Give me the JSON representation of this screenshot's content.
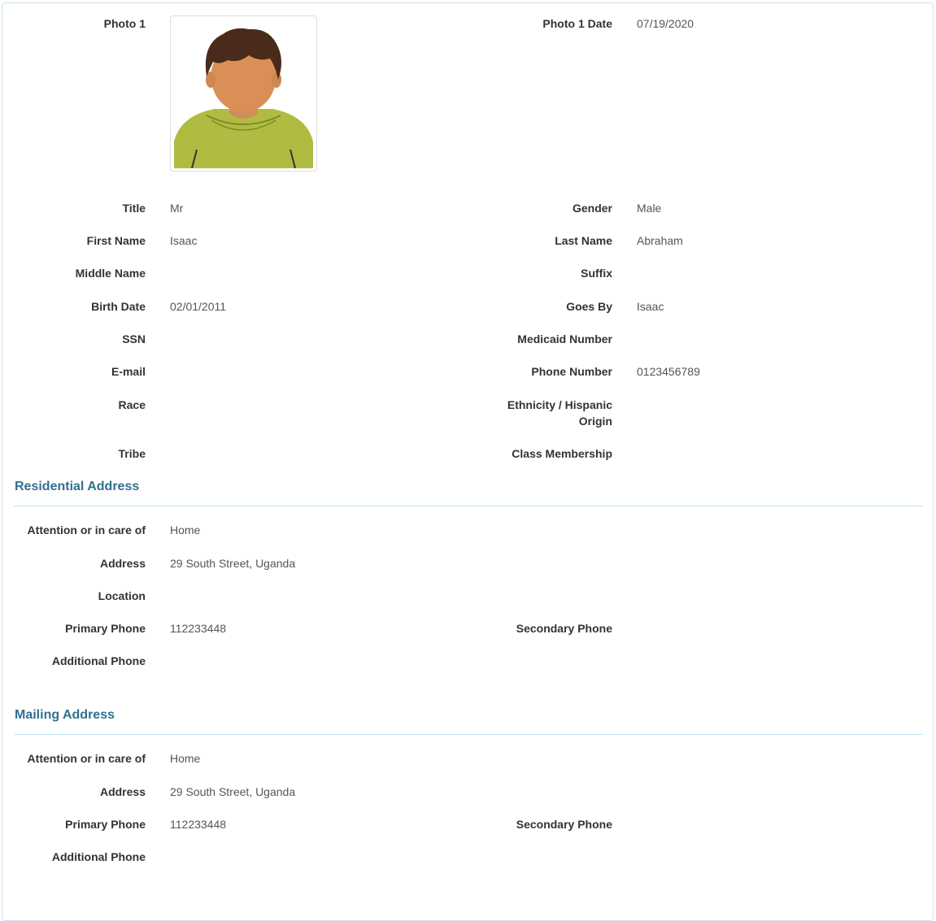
{
  "photo": {
    "label": "Photo 1",
    "date_label": "Photo 1 Date",
    "date": "07/19/2020",
    "icon": "avatar-boy-icon"
  },
  "person": {
    "title_label": "Title",
    "title": "Mr",
    "gender_label": "Gender",
    "gender": "Male",
    "first_name_label": "First Name",
    "first_name": "Isaac",
    "last_name_label": "Last Name",
    "last_name": "Abraham",
    "middle_name_label": "Middle Name",
    "middle_name": "",
    "suffix_label": "Suffix",
    "suffix": "",
    "birth_date_label": "Birth Date",
    "birth_date": "02/01/2011",
    "goes_by_label": "Goes By",
    "goes_by": "Isaac",
    "ssn_label": "SSN",
    "ssn": "",
    "medicaid_label": "Medicaid Number",
    "medicaid": "",
    "email_label": "E-mail",
    "email": "",
    "phone_label": "Phone Number",
    "phone": "0123456789",
    "race_label": "Race",
    "race": "",
    "ethnicity_label_line1": "Ethnicity / Hispanic",
    "ethnicity_label_line2": "Origin",
    "ethnicity": "",
    "tribe_label": "Tribe",
    "tribe": "",
    "class_membership_label": "Class Membership",
    "class_membership": ""
  },
  "residential": {
    "heading": "Residential Address",
    "attention_label": "Attention or in care of",
    "attention": "Home",
    "address_label": "Address",
    "address": "29 South Street, Uganda",
    "location_label": "Location",
    "location": "",
    "primary_phone_label": "Primary Phone",
    "primary_phone": "112233448",
    "secondary_phone_label": "Secondary Phone",
    "secondary_phone": "",
    "additional_phone_label": "Additional Phone",
    "additional_phone": ""
  },
  "mailing": {
    "heading": "Mailing Address",
    "attention_label": "Attention or in care of",
    "attention": "Home",
    "address_label": "Address",
    "address": "29 South Street, Uganda",
    "primary_phone_label": "Primary Phone",
    "primary_phone": "112233448",
    "secondary_phone_label": "Secondary Phone",
    "secondary_phone": "",
    "additional_phone_label": "Additional Phone",
    "additional_phone": ""
  },
  "colors": {
    "section_heading": "#31708f",
    "section_rule": "#bce8f1",
    "label_text": "#333333",
    "value_text": "#555555"
  }
}
